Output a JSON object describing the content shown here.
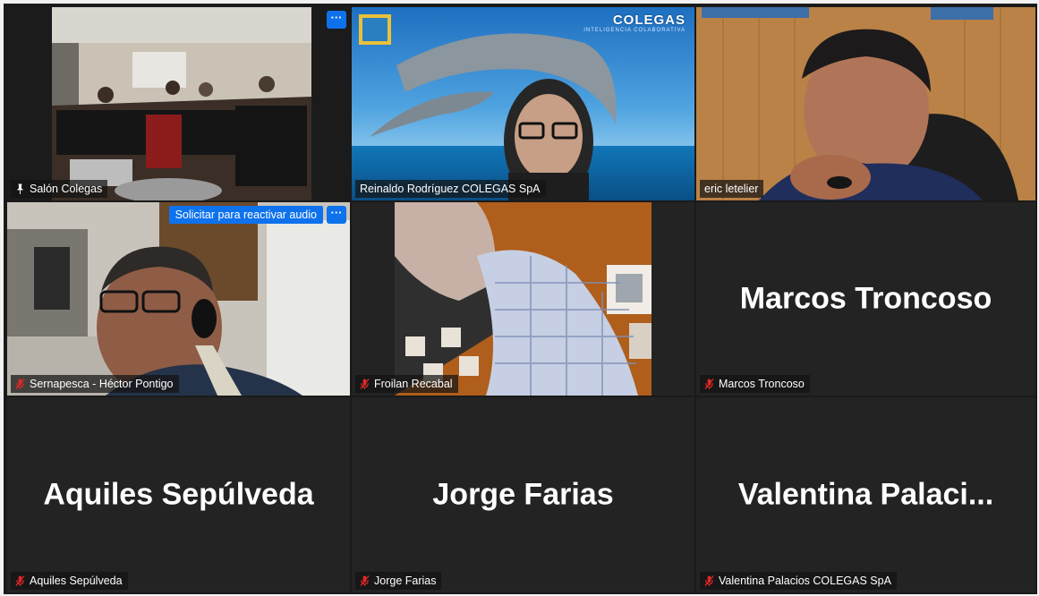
{
  "tiles": [
    {
      "name": "Salón Colegas",
      "state": "speaking-pinned",
      "has_video": true
    },
    {
      "name": "Reinaldo Rodríguez  COLEGAS SpA",
      "state": "video",
      "has_video": true,
      "background": {
        "brand": "COLEGAS",
        "tagline": "INTELIGENCIA COLABORATIVA"
      }
    },
    {
      "name": "eric letelier",
      "state": "video",
      "has_video": true
    },
    {
      "name": "Sernapesca - Héctor Pontigo",
      "state": "muted",
      "has_video": true,
      "action_button": "Solicitar para reactivar audio"
    },
    {
      "name": "Froilan Recabal",
      "state": "muted",
      "has_video": true
    },
    {
      "name": "Marcos Troncoso",
      "display_name": "Marcos Troncoso",
      "state": "muted",
      "has_video": false
    },
    {
      "name": "Aquiles Sepúlveda",
      "display_name": "Aquiles Sepúlveda",
      "state": "muted",
      "has_video": false
    },
    {
      "name": "Jorge Farias",
      "display_name": "Jorge Farias",
      "state": "muted",
      "has_video": false
    },
    {
      "name": "Valentina Palacios COLEGAS SpA",
      "display_name": "Valentina  Palaci...",
      "state": "muted",
      "has_video": false
    }
  ],
  "more_options_label": "···",
  "icons": {
    "pinned": "pin-icon",
    "muted": "mic-muted-icon",
    "more": "more-options-icon"
  },
  "colors": {
    "active_border": "#d7d27a",
    "button_blue": "#0e72ed",
    "muted_red": "#e02828"
  }
}
